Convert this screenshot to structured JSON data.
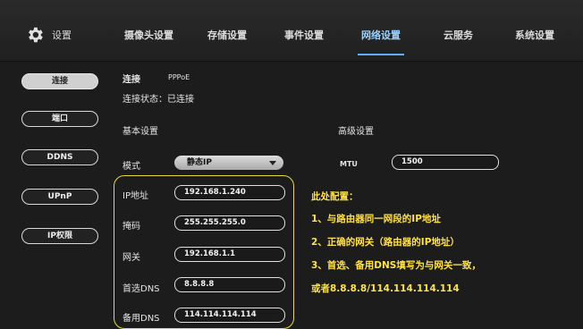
{
  "header": {
    "settings_label": "设置",
    "tabs": [
      {
        "label": "摄像头设置"
      },
      {
        "label": "存储设置"
      },
      {
        "label": "事件设置"
      },
      {
        "label": "网络设置"
      },
      {
        "label": "云服务"
      },
      {
        "label": "系统设置"
      }
    ],
    "active_tab": "网络设置"
  },
  "sidebar": {
    "items": [
      {
        "label": "连接"
      },
      {
        "label": "端口"
      },
      {
        "label": "DDNS"
      },
      {
        "label": "UPnP"
      },
      {
        "label": "IP权限"
      }
    ],
    "active": "连接"
  },
  "main": {
    "subtabs": [
      {
        "label": "连接"
      },
      {
        "label": "PPPoE"
      }
    ],
    "status": "连接状态：已连接",
    "basic_title": "基本设置",
    "advanced_title": "高级设置",
    "mode_label": "模式",
    "mode_value": "静态IP",
    "mtu_label": "MTU",
    "mtu_value": "1500",
    "fields": [
      {
        "label": "IP地址",
        "value": "192.168.1.240"
      },
      {
        "label": "掩码",
        "value": "255.255.255.0"
      },
      {
        "label": "网关",
        "value": "192.168.1.1"
      },
      {
        "label": "首选DNS",
        "value": "8.8.8.8"
      },
      {
        "label": "备用DNS",
        "value": "114.114.114.114"
      }
    ]
  },
  "annotation": {
    "title": "此处配置：",
    "lines": [
      "1、与路由器同一网段的IP地址",
      "2、正确的网关（路由器的IP地址）",
      "3、首选、备用DNS填写为与网关一致，",
      "或者8.8.8.8/114.114.114.114"
    ],
    "color": "#ffe14a"
  }
}
